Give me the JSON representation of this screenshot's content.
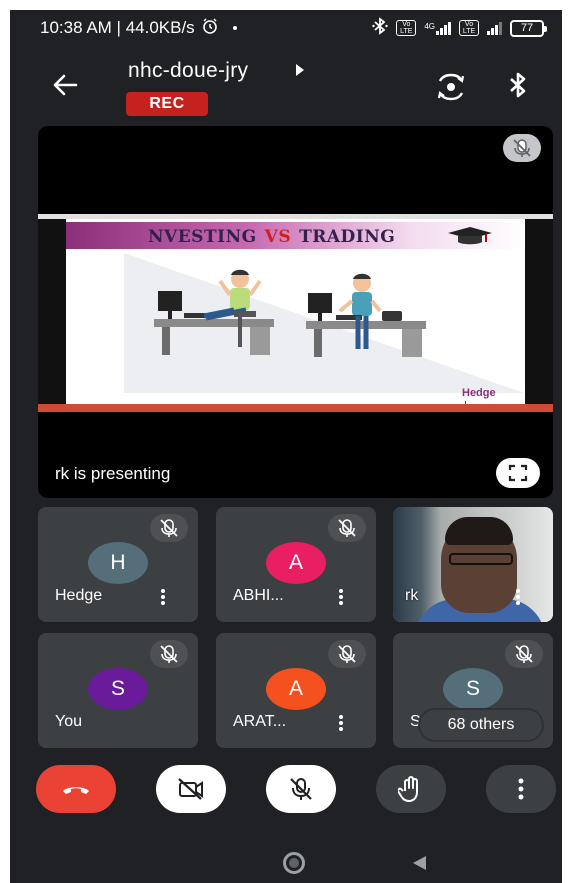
{
  "status_bar": {
    "time_and_speed": "10:38 AM | 44.0KB/s",
    "volte_1": "Vo LTE",
    "network_type": "4G",
    "volte_2": "Vo LTE",
    "battery": "77"
  },
  "header": {
    "meeting_code": "nhc-doue-jry",
    "rec_label": "REC"
  },
  "presentation": {
    "slide_title_left": "NVESTING",
    "slide_title_vs": "VS",
    "slide_title_right": "TRADING",
    "slide_logo": "Hedge",
    "presenting_text": "rk is presenting"
  },
  "participants": [
    {
      "initial": "H",
      "name": "Hedge",
      "color": "#546e7a"
    },
    {
      "initial": "A",
      "name": "ABHI...",
      "color": "#e91e63"
    },
    {
      "name": "rk"
    },
    {
      "initial": "S",
      "name": "You",
      "color": "#6a1b9a"
    },
    {
      "initial": "A",
      "name": "ARAT...",
      "color": "#f4511e"
    },
    {
      "initial": "S",
      "name": "Sh",
      "color": "#546e7a"
    }
  ],
  "others_count_label": "68 others",
  "colors": {
    "background": "#202124",
    "tile": "#3c4043",
    "rec": "#c5221f",
    "end_call": "#ea4335"
  },
  "icons": {
    "alarm": "alarm-icon",
    "bluetooth": "bluetooth-icon",
    "back": "arrow-left-icon",
    "switch_camera": "switch-camera-icon",
    "fullscreen": "fullscreen-icon",
    "mic_off": "mic-off-icon",
    "end_call": "phone-hangup-icon",
    "camera_off": "video-off-icon",
    "raise_hand": "hand-icon",
    "more": "more-vert-icon"
  }
}
